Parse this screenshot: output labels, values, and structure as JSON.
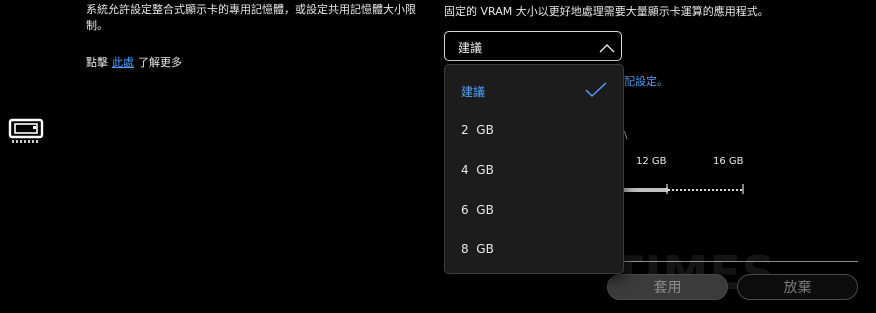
{
  "left": {
    "description": "系統允許設定整合式顯示卡的專用記憶體，或設定共用記憶體大小限制。",
    "learn_prefix": "點擊",
    "learn_link": "此處",
    "learn_suffix": "了解更多",
    "icon": "gpu-card-icon"
  },
  "right": {
    "description": "固定的 VRAM 大小以更好地處理需要大量顯示卡運算的應用程式。",
    "select": {
      "value": "建議",
      "icon": "chevron-up-icon"
    },
    "menu": {
      "items": [
        {
          "label": "建議",
          "selected": true
        },
        {
          "label": "2  GB",
          "selected": false
        },
        {
          "label": "4  GB",
          "selected": false
        },
        {
          "label": "6  GB",
          "selected": false
        },
        {
          "label": "8  GB",
          "selected": false
        }
      ],
      "check_icon": "checkmark-icon"
    },
    "background": {
      "partial_link": "配設定。",
      "partial_text": "\\",
      "ticks": [
        "12 GB",
        "16 GB"
      ]
    }
  },
  "buttons": {
    "apply": "套用",
    "discard": "放棄"
  },
  "watermark": "TIMES",
  "colors": {
    "accent": "#4ea1ff",
    "background": "#000000",
    "menu_bg": "#1c1c1c"
  }
}
